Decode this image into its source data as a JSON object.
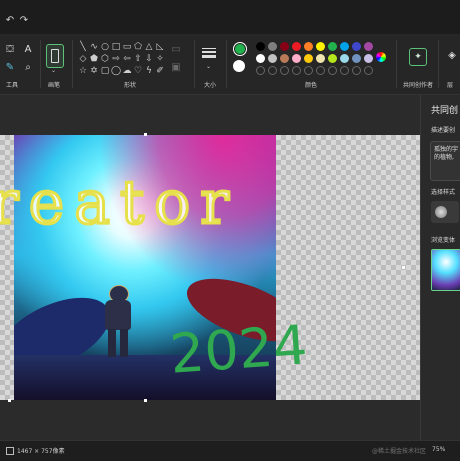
{
  "ribbon": {
    "tools_label": "工具",
    "brush_label": "画笔",
    "shapes_label": "形状",
    "size_label": "大小",
    "colors_label": "颜色",
    "cocreator_label": "共同创作者",
    "layers_label": "层"
  },
  "colors": {
    "primary": "#22b14c",
    "secondary": "#ffffff",
    "row1": [
      "#000000",
      "#7f7f7f",
      "#880015",
      "#ed1c24",
      "#ff7f27",
      "#fff200",
      "#22b14c",
      "#00a2e8",
      "#3f48cc",
      "#a349a4"
    ],
    "row2": [
      "#ffffff",
      "#c3c3c3",
      "#b97a57",
      "#ffaec9",
      "#ffc90e",
      "#efe4b0",
      "#b5e61d",
      "#99d9ea",
      "#7092be",
      "#c8bfe7"
    ]
  },
  "canvas": {
    "overlay_text": "reator",
    "year_text": "2024"
  },
  "panel": {
    "title": "共同创",
    "describe_label": "描述要创",
    "prompt_text": "孤独的宇\n的植物,",
    "style_label": "选择样式",
    "variants_label": "浏览变体"
  },
  "status": {
    "dimensions": "1467 × 757像素",
    "zoom": "75%",
    "watermark": "@稀土掘金技术社区"
  }
}
